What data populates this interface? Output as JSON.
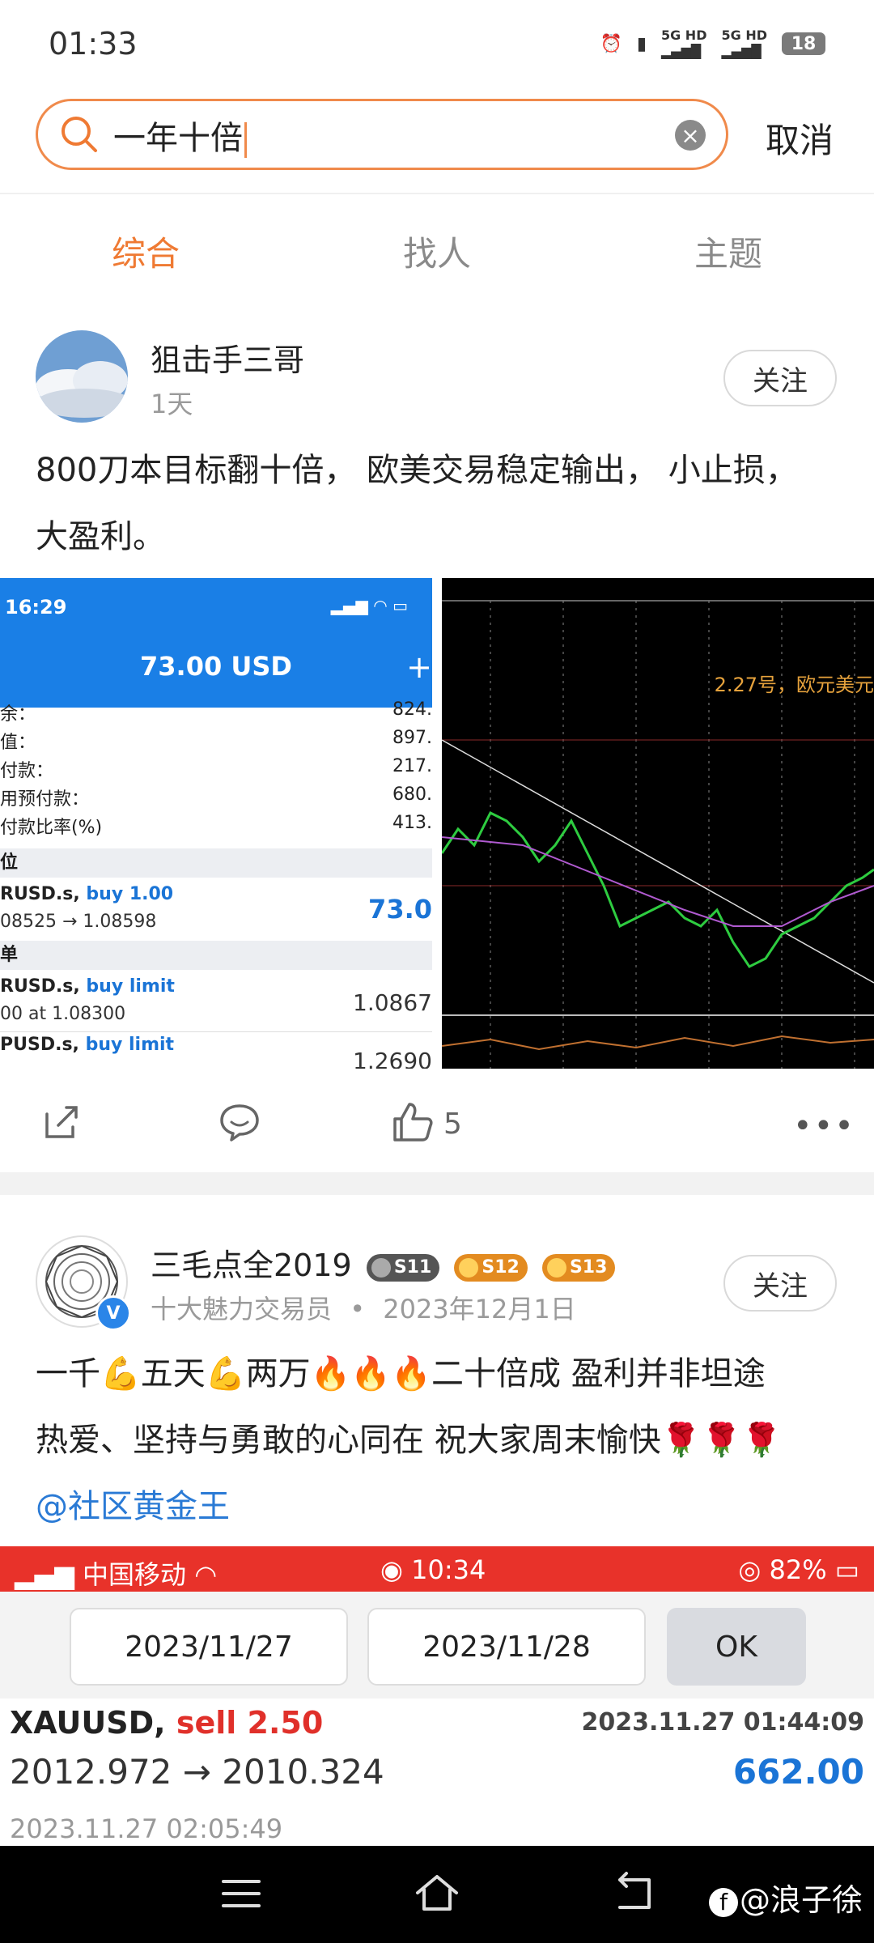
{
  "status_bar": {
    "time": "01:33",
    "net1": "5G HD",
    "net2": "5G HD",
    "battery": "18"
  },
  "search": {
    "query": "一年十倍",
    "cancel_label": "取消"
  },
  "tabs": [
    {
      "label": "综合"
    },
    {
      "label": "找人"
    },
    {
      "label": "主题"
    }
  ],
  "posts": [
    {
      "user": "狙击手三哥",
      "time": "1天",
      "follow_label": "关注",
      "text": "800刀本目标翻十倍， 欧美交易稳定输出， 小止损，大盈利。",
      "likes": "5",
      "image1": {
        "time": "16:29",
        "balance": "73.00 USD",
        "rows": [
          {
            "label": "余：",
            "value": "824."
          },
          {
            "label": "值：",
            "value": "897."
          },
          {
            "label": "付款：",
            "value": "217."
          },
          {
            "label": "用预付款：",
            "value": "680."
          },
          {
            "label": "付款比率(%)",
            "value": "413."
          }
        ],
        "section1": "位",
        "pos_symbol": "RUSD.s,",
        "pos_side": "buy 1.00",
        "pos_price": "08525 → 1.08598",
        "pos_profit": "73.0",
        "section2": "单",
        "order1_symbol": "RUSD.s,",
        "order1_side": "buy limit",
        "order1_detail": "00 at 1.08300",
        "order1_price": "1.0867",
        "order2_symbol": "PUSD.s,",
        "order2_side": "buy limit",
        "order2_price": "1.2690"
      },
      "image2": {
        "annotation": "2.27号，欧元美元"
      }
    },
    {
      "user": "三毛点全2019",
      "badges": [
        "S11",
        "S12",
        "S13"
      ],
      "title_tag": "十大魅力交易员",
      "date": "2023年12月1日",
      "follow_label": "关注",
      "line1": "一千💪五天💪两万🔥🔥🔥二十倍成 盈利并非坦途",
      "line2": "热爱、坚持与勇敢的心同在 祝大家周末愉快🌹🌹🌹",
      "mention": "@社区黄金王",
      "image": {
        "carrier": "中国移动",
        "time": "10:34",
        "battery": "82%",
        "date_from": "2023/11/27",
        "date_to": "2023/11/28",
        "ok_label": "OK",
        "symbol": "XAUUSD,",
        "side": "sell 2.50",
        "open_time": "2023.11.27 01:44:09",
        "prices": "2012.972 → 2010.324",
        "profit": "662.00",
        "close_time": "2023.11.27 02:05:49"
      }
    }
  ],
  "watermark": "@浪子徐",
  "colors": {
    "accent": "#ef7a33",
    "link": "#2a7ad5",
    "profit_blue": "#1a74d6",
    "sell_red": "#e0302a"
  }
}
